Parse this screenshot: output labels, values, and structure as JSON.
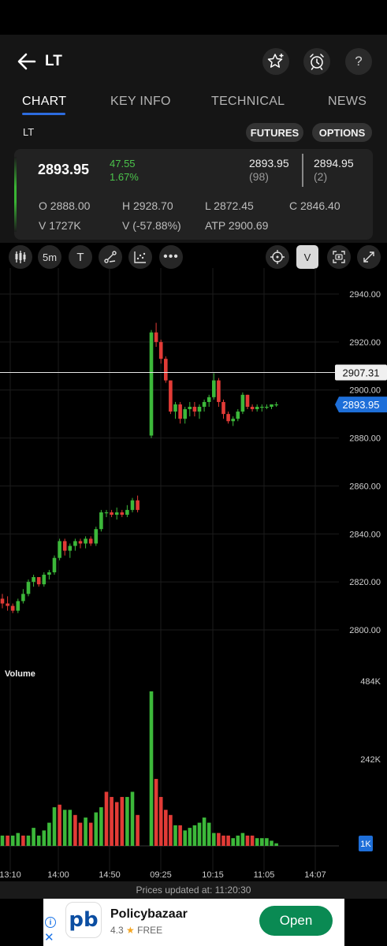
{
  "header": {
    "symbol": "LT"
  },
  "tabs": [
    {
      "label": "CHART",
      "active": true
    },
    {
      "label": "KEY INFO"
    },
    {
      "label": "TECHNICAL"
    },
    {
      "label": "NEWS"
    }
  ],
  "sub": {
    "symbol": "LT",
    "futures": "FUTURES",
    "options": "OPTIONS"
  },
  "quote": {
    "ltp": "2893.95",
    "change": "47.55",
    "change_pct": "1.67%",
    "bid_price": "2893.95",
    "bid_qty": "(98)",
    "ask_price": "2894.95",
    "ask_qty": "(2)",
    "open": "O 2888.00",
    "high": "H 2928.70",
    "low": "L 2872.45",
    "close": "C 2846.40",
    "volume": "V 1727K",
    "vol_change": "V (-57.88%)",
    "atp": "ATP 2900.69"
  },
  "toolbar": {
    "interval": "5m",
    "text_tool": "T",
    "volume_toggle": "V"
  },
  "chart_data": {
    "type": "candlestick",
    "price_axis_ticks": [
      "2940.00",
      "2920.00",
      "2900.00",
      "2880.00",
      "2860.00",
      "2840.00",
      "2820.00",
      "2800.00"
    ],
    "crosshair_label": "2907.31",
    "last_price_label": "2893.95",
    "volume_title": "Volume",
    "volume_axis_ticks": [
      "484K",
      "242K"
    ],
    "volume_marker": "1K",
    "time_ticks": [
      "13:10",
      "14:00",
      "14:50",
      "09:25",
      "10:15",
      "11:05",
      "14:07"
    ],
    "candles": [
      [
        2813,
        2815,
        2809,
        2811
      ],
      [
        2811,
        2814,
        2808,
        2810
      ],
      [
        2810,
        2811,
        2807,
        2808
      ],
      [
        2808,
        2813,
        2807,
        2812
      ],
      [
        2812,
        2817,
        2811,
        2815
      ],
      [
        2815,
        2821,
        2814,
        2820
      ],
      [
        2820,
        2823,
        2818,
        2822
      ],
      [
        2822,
        2822,
        2818,
        2819
      ],
      [
        2819,
        2824,
        2818,
        2823
      ],
      [
        2823,
        2825,
        2821,
        2824
      ],
      [
        2824,
        2831,
        2823,
        2830
      ],
      [
        2830,
        2838,
        2829,
        2837
      ],
      [
        2837,
        2838,
        2831,
        2833
      ],
      [
        2833,
        2836,
        2830,
        2835
      ],
      [
        2835,
        2838,
        2833,
        2837
      ],
      [
        2837,
        2838,
        2834,
        2836
      ],
      [
        2836,
        2839,
        2834,
        2838
      ],
      [
        2838,
        2839,
        2835,
        2836
      ],
      [
        2836,
        2843,
        2835,
        2842
      ],
      [
        2842,
        2850,
        2841,
        2849
      ],
      [
        2849,
        2850,
        2847,
        2849
      ],
      [
        2849,
        2850,
        2847,
        2848
      ],
      [
        2848,
        2851,
        2846,
        2849
      ],
      [
        2849,
        2850,
        2847,
        2848
      ],
      [
        2848,
        2852,
        2847,
        2850
      ],
      [
        2850,
        2855,
        2849,
        2854
      ],
      [
        2854,
        2856,
        2849,
        2850
      ],
      [
        2881,
        2925,
        2880,
        2924
      ],
      [
        2924,
        2928,
        2918,
        2920
      ],
      [
        2920,
        2921,
        2911,
        2913
      ],
      [
        2913,
        2914,
        2903,
        2904
      ],
      [
        2904,
        2904,
        2890,
        2891
      ],
      [
        2891,
        2895,
        2888,
        2894
      ],
      [
        2894,
        2895,
        2886,
        2888
      ],
      [
        2888,
        2893,
        2886,
        2892
      ],
      [
        2892,
        2895,
        2889,
        2893
      ],
      [
        2893,
        2895,
        2889,
        2891
      ],
      [
        2891,
        2894,
        2888,
        2893
      ],
      [
        2893,
        2896,
        2891,
        2895
      ],
      [
        2895,
        2898,
        2893,
        2897
      ],
      [
        2897,
        2907,
        2896,
        2904
      ],
      [
        2904,
        2905,
        2893,
        2895
      ],
      [
        2895,
        2896,
        2888,
        2890
      ],
      [
        2890,
        2891,
        2886,
        2887
      ],
      [
        2887,
        2889,
        2885,
        2888
      ],
      [
        2888,
        2892,
        2887,
        2891
      ],
      [
        2891,
        2899,
        2890,
        2898
      ],
      [
        2898,
        2898,
        2892,
        2893
      ],
      [
        2893,
        2894,
        2891,
        2892
      ],
      [
        2892,
        2894,
        2891,
        2893
      ],
      [
        2893,
        2894,
        2891,
        2893
      ],
      [
        2893,
        2894,
        2892,
        2893
      ],
      [
        2893,
        2894,
        2892,
        2894
      ],
      [
        2894,
        2895,
        2893,
        2894
      ]
    ],
    "volumes": [
      [
        4,
        1
      ],
      [
        4,
        0
      ],
      [
        4,
        1
      ],
      [
        5,
        1
      ],
      [
        4,
        0
      ],
      [
        4,
        1
      ],
      [
        7,
        1
      ],
      [
        4,
        1
      ],
      [
        6,
        1
      ],
      [
        9,
        1
      ],
      [
        15,
        1
      ],
      [
        16,
        0
      ],
      [
        14,
        1
      ],
      [
        14,
        1
      ],
      [
        12,
        0
      ],
      [
        9,
        0
      ],
      [
        11,
        1
      ],
      [
        9,
        0
      ],
      [
        13,
        1
      ],
      [
        15,
        1
      ],
      [
        21,
        0
      ],
      [
        19,
        0
      ],
      [
        17,
        0
      ],
      [
        19,
        0
      ],
      [
        19,
        1
      ],
      [
        21,
        1
      ],
      [
        12,
        0
      ],
      [
        60,
        1
      ],
      [
        26,
        0
      ],
      [
        19,
        0
      ],
      [
        14,
        0
      ],
      [
        12,
        0
      ],
      [
        8,
        1
      ],
      [
        8,
        0
      ],
      [
        6,
        1
      ],
      [
        7,
        1
      ],
      [
        8,
        1
      ],
      [
        9,
        1
      ],
      [
        11,
        1
      ],
      [
        9,
        1
      ],
      [
        5,
        1
      ],
      [
        5,
        0
      ],
      [
        4,
        0
      ],
      [
        4,
        0
      ],
      [
        3,
        1
      ],
      [
        4,
        1
      ],
      [
        5,
        1
      ],
      [
        4,
        0
      ],
      [
        4,
        0
      ],
      [
        3,
        1
      ],
      [
        3,
        1
      ],
      [
        3,
        1
      ],
      [
        2,
        1
      ],
      [
        1,
        1
      ]
    ],
    "colors": {
      "up": "#3cb83a",
      "down": "#e23b36",
      "grid": "#1c1c1c"
    }
  },
  "status": {
    "updated": "Prices updated at:  11:20:30"
  },
  "ad": {
    "logo": "pb",
    "name": "Policybazaar",
    "rating": "4.3",
    "price": "FREE",
    "cta": "Open"
  }
}
